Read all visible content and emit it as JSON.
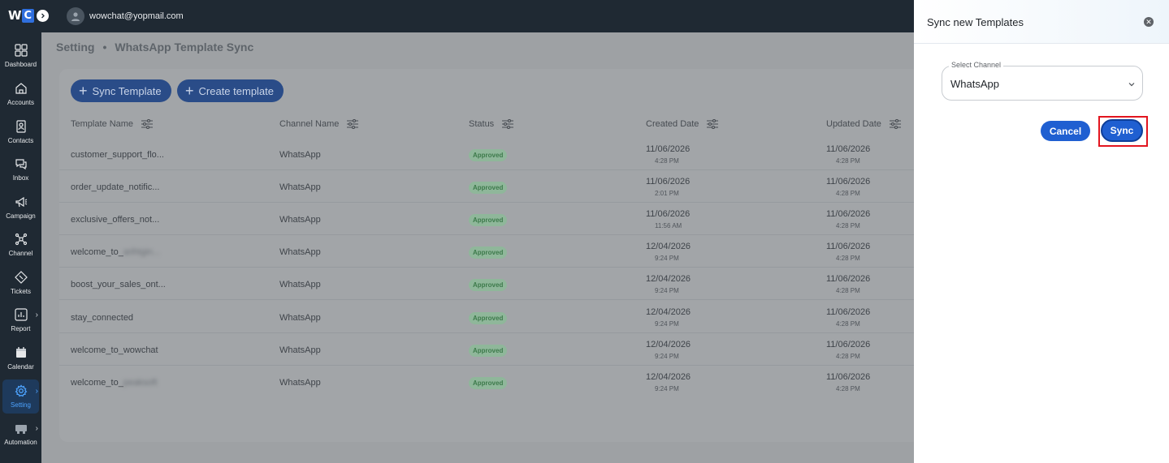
{
  "app": {
    "logo_w": "W",
    "logo_c": "C",
    "user_email": "wowchat@yopmail.com"
  },
  "sidebar": {
    "items": [
      {
        "label": "Dashboard",
        "icon": "dashboard-icon"
      },
      {
        "label": "Accounts",
        "icon": "home-icon"
      },
      {
        "label": "Contacts",
        "icon": "contact-card-icon"
      },
      {
        "label": "Inbox",
        "icon": "chat-bubbles-icon"
      },
      {
        "label": "Campaign",
        "icon": "megaphone-icon"
      },
      {
        "label": "Channel",
        "icon": "network-icon"
      },
      {
        "label": "Tickets",
        "icon": "ticket-icon"
      },
      {
        "label": "Report",
        "icon": "report-chart-icon"
      },
      {
        "label": "Calendar",
        "icon": "calendar-icon"
      },
      {
        "label": "Setting",
        "icon": "gear-icon"
      },
      {
        "label": "Automation",
        "icon": "automation-icon"
      }
    ]
  },
  "breadcrumb": {
    "root": "Setting",
    "separator": "•",
    "current": "WhatsApp Template Sync"
  },
  "toolbar": {
    "sync_template": "Sync Template",
    "create_template": "Create template"
  },
  "table": {
    "headers": [
      "Template Name",
      "Channel Name",
      "Status",
      "Created Date",
      "Updated Date"
    ],
    "rows": [
      {
        "name": "customer_support_flo...",
        "channel": "WhatsApp",
        "status": "Approved",
        "created_date": "11/06/2026",
        "created_time": "4:28 PM",
        "updated_date": "11/06/2026",
        "updated_time": "4:28 PM"
      },
      {
        "name": "order_update_notific...",
        "channel": "WhatsApp",
        "status": "Approved",
        "created_date": "11/06/2026",
        "created_time": "2:01 PM",
        "updated_date": "11/06/2026",
        "updated_time": "4:28 PM"
      },
      {
        "name": "exclusive_offers_not...",
        "channel": "WhatsApp",
        "status": "Approved",
        "created_date": "11/06/2026",
        "created_time": "11:56 AM",
        "updated_date": "11/06/2026",
        "updated_time": "4:28 PM"
      },
      {
        "name": "welcome_to_",
        "name_blur": "arihtgin...",
        "channel": "WhatsApp",
        "status": "Approved",
        "created_date": "12/04/2026",
        "created_time": "9:24 PM",
        "updated_date": "11/06/2026",
        "updated_time": "4:28 PM"
      },
      {
        "name": "boost_your_sales_ont...",
        "channel": "WhatsApp",
        "status": "Approved",
        "created_date": "12/04/2026",
        "created_time": "9:24 PM",
        "updated_date": "11/06/2026",
        "updated_time": "4:28 PM"
      },
      {
        "name": "stay_connected",
        "channel": "WhatsApp",
        "status": "Approved",
        "created_date": "12/04/2026",
        "created_time": "9:24 PM",
        "updated_date": "11/06/2026",
        "updated_time": "4:28 PM"
      },
      {
        "name": "welcome_to_wowchat",
        "channel": "WhatsApp",
        "status": "Approved",
        "created_date": "12/04/2026",
        "created_time": "9:24 PM",
        "updated_date": "11/06/2026",
        "updated_time": "4:28 PM"
      },
      {
        "name": "welcome_to_",
        "name_blur": "peaksoft",
        "channel": "WhatsApp",
        "status": "Approved",
        "created_date": "12/04/2026",
        "created_time": "9:24 PM",
        "updated_date": "11/06/2026",
        "updated_time": "4:28 PM"
      }
    ]
  },
  "panel": {
    "title": "Sync new Templates",
    "select_label": "Select Channel",
    "select_value": "WhatsApp",
    "cancel_label": "Cancel",
    "sync_label": "Sync"
  },
  "colors": {
    "sidebar_bg": "#1f2933",
    "accent": "#1f5fd1",
    "highlight": "#e2151f",
    "badge_text": "#3d7a4b"
  }
}
